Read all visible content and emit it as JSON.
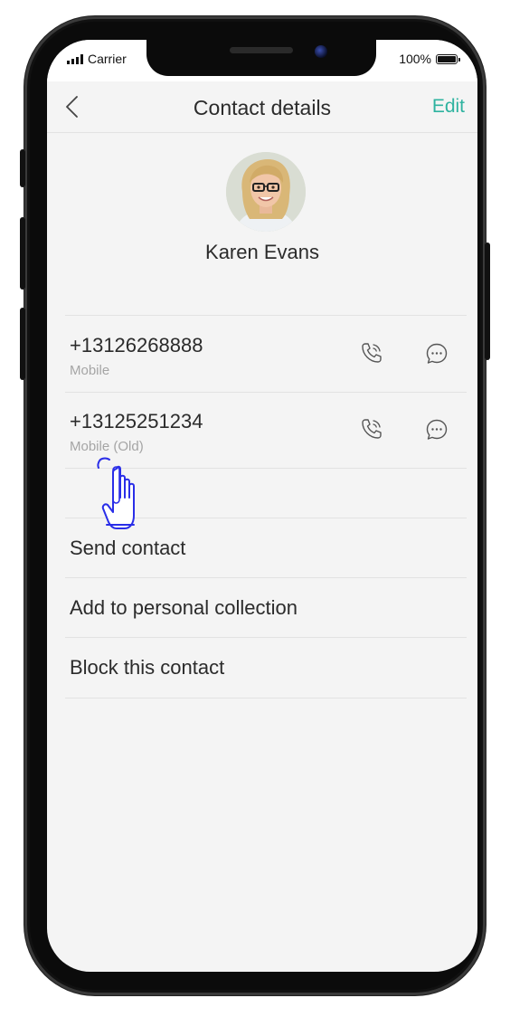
{
  "status_bar": {
    "carrier": "Carrier",
    "battery": "100%"
  },
  "nav": {
    "back_icon": "chevron-left-icon",
    "title": "Contact details",
    "edit_label": "Edit",
    "accent_color": "#2fb3a0"
  },
  "contact": {
    "name": "Karen Evans",
    "avatar": "avatar-photo"
  },
  "phones": [
    {
      "number": "+13126268888",
      "label": "Mobile",
      "call_icon": "phone-call-icon",
      "message_icon": "chat-bubble-icon"
    },
    {
      "number": "+13125251234",
      "label": "Mobile (Old)",
      "call_icon": "phone-call-icon",
      "message_icon": "chat-bubble-icon"
    }
  ],
  "actions": [
    {
      "label": "Send contact"
    },
    {
      "label": "Add to personal collection"
    },
    {
      "label": "Block this contact"
    }
  ],
  "overlay": {
    "hand_icon": "tap-hand-icon",
    "hand_color": "#2a2ee8"
  }
}
